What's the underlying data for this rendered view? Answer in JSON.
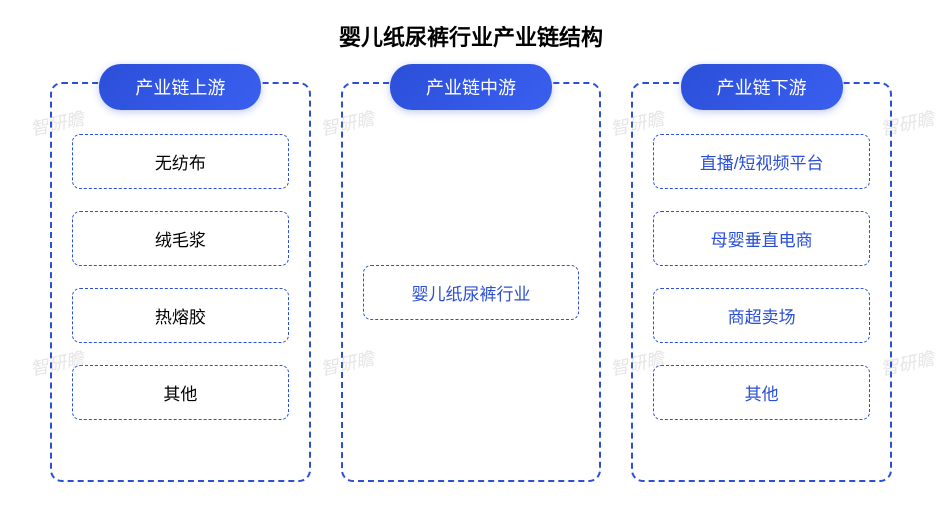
{
  "title": "婴儿纸尿裤行业产业链结构",
  "watermark": "智研瞻",
  "columns": [
    {
      "header": "产业链上游",
      "items": [
        "无纺布",
        "绒毛浆",
        "热熔胶",
        "其他"
      ],
      "textColor": "black"
    },
    {
      "header": "产业链中游",
      "items": [
        "婴儿纸尿裤行业"
      ],
      "textColor": "blue",
      "centered": true
    },
    {
      "header": "产业链下游",
      "items": [
        "直播/短视频平台",
        "母婴垂直电商",
        "商超卖场",
        "其他"
      ],
      "textColor": "blue"
    }
  ]
}
